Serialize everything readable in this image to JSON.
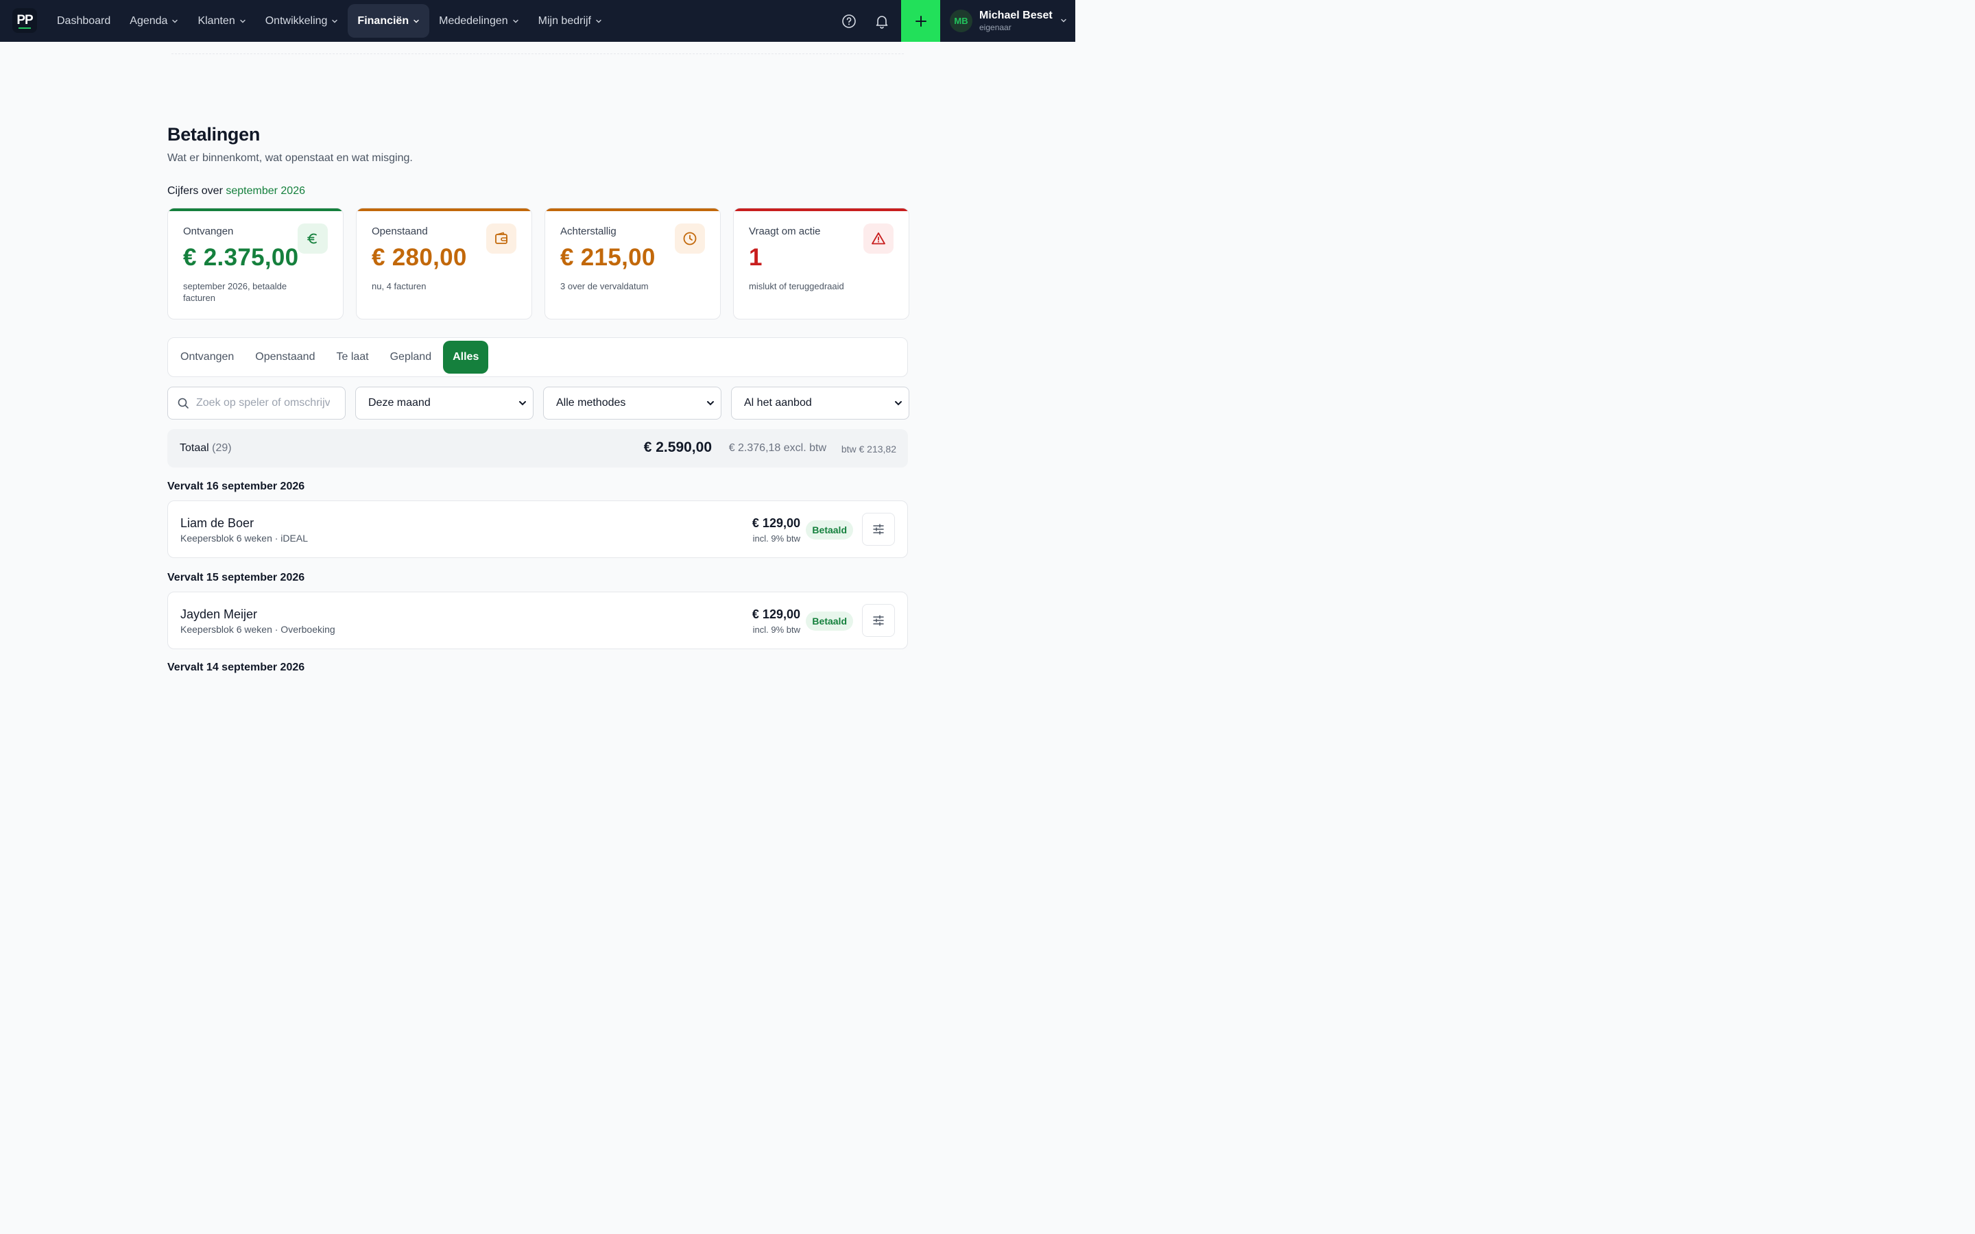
{
  "nav": {
    "logo": "PP",
    "items": [
      {
        "label": "Dashboard",
        "dropdown": false
      },
      {
        "label": "Agenda",
        "dropdown": true
      },
      {
        "label": "Klanten",
        "dropdown": true
      },
      {
        "label": "Ontwikkeling",
        "dropdown": true
      },
      {
        "label": "Financiën",
        "dropdown": true,
        "active": true
      },
      {
        "label": "Mededelingen",
        "dropdown": true
      },
      {
        "label": "Mijn bedrijf",
        "dropdown": true
      }
    ],
    "icons": [
      "help-icon",
      "bell-icon",
      "plus-icon"
    ],
    "user": {
      "initials": "MB",
      "name": "Michael Beset",
      "role": "eigenaar"
    }
  },
  "page": {
    "title": "Betalingen",
    "subtitle": "Wat er binnenkomt, wat openstaat en wat misging.",
    "period_prefix": "Cijfers over",
    "period_value": "september 2026"
  },
  "cards": [
    {
      "label": "Ontvangen",
      "value": "€ 2.375,00",
      "desc": "september 2026, betaalde facturen",
      "color": "#15803d",
      "tint": "#e8f6ec",
      "icon": "euro-icon"
    },
    {
      "label": "Openstaand",
      "value": "€ 280,00",
      "desc": "nu, 4 facturen",
      "color": "#c2680a",
      "tint": "#fdf0e3",
      "icon": "wallet-icon"
    },
    {
      "label": "Achterstallig",
      "value": "€ 215,00",
      "desc": "3 over de vervaldatum",
      "color": "#c2680a",
      "tint": "#fdf0e3",
      "icon": "clock-icon"
    },
    {
      "label": "Vraagt om actie",
      "value": "1",
      "desc": "mislukt of teruggedraaid",
      "color": "#c81e1e",
      "tint": "#fdecec",
      "icon": "warning-icon"
    }
  ],
  "tabs": [
    {
      "label": "Ontvangen",
      "active": false
    },
    {
      "label": "Openstaand",
      "active": false
    },
    {
      "label": "Te laat",
      "active": false
    },
    {
      "label": "Gepland",
      "active": false
    },
    {
      "label": "Alles",
      "active": true
    }
  ],
  "filters": {
    "search_placeholder": "Zoek op speler of omschrijving",
    "period": "Deze maand",
    "method": "Alle methodes",
    "offer": "Al het aanbod"
  },
  "total": {
    "label": "Totaal",
    "count": "(29)",
    "amount": "€ 2.590,00",
    "excl": "€ 2.376,18 excl. btw",
    "btw": "btw € 213,82"
  },
  "groups": [
    {
      "heading": "Vervalt 16 september 2026",
      "rows": [
        {
          "name": "Liam de Boer",
          "meta": "Keepersblok 6 weken · iDEAL",
          "amount": "€ 129,00",
          "btw": "incl. 9% btw",
          "status": "Betaald"
        }
      ]
    },
    {
      "heading": "Vervalt 15 september 2026",
      "rows": [
        {
          "name": "Jayden Meijer",
          "meta": "Keepersblok 6 weken · Overboeking",
          "amount": "€ 129,00",
          "btw": "incl. 9% btw",
          "status": "Betaald"
        }
      ]
    },
    {
      "heading": "Vervalt 14 september 2026",
      "rows": []
    }
  ]
}
